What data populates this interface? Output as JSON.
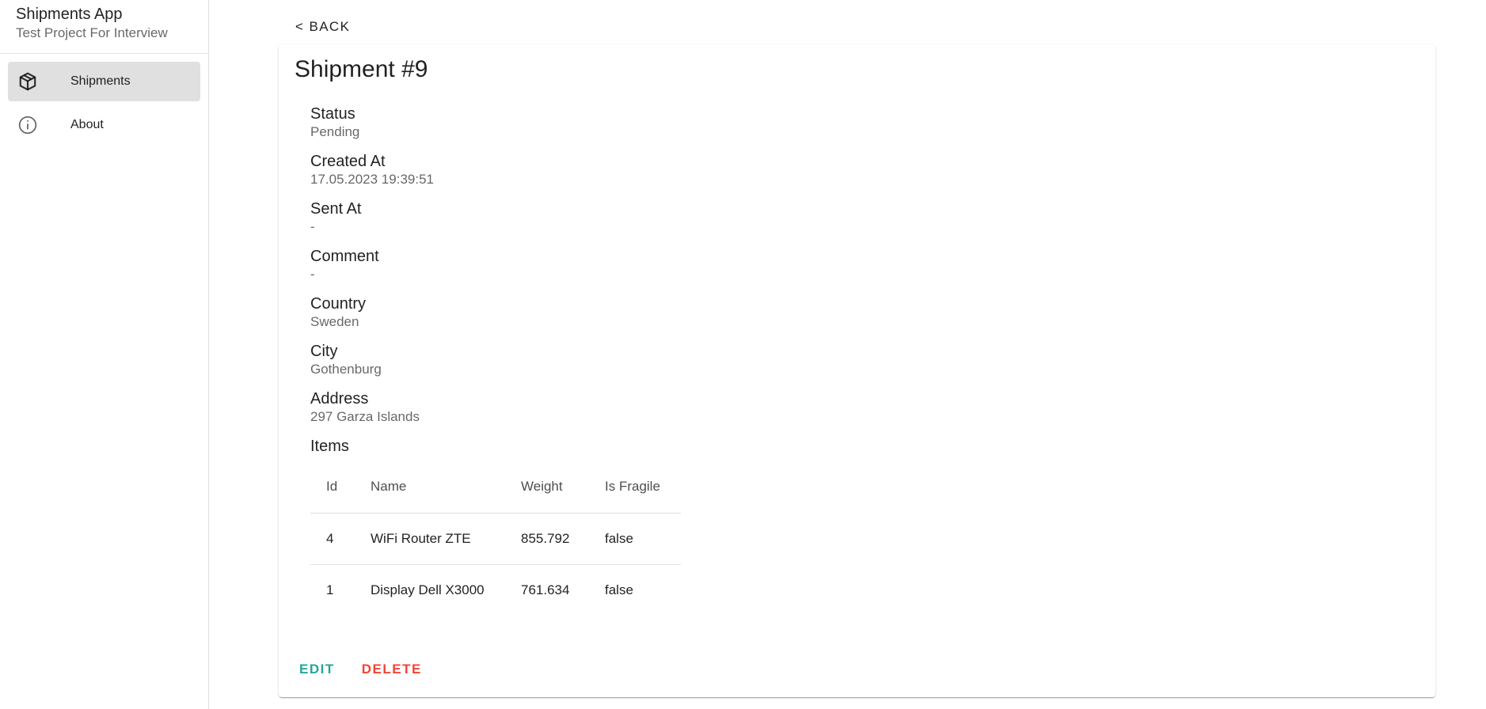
{
  "app": {
    "title": "Shipments App",
    "subtitle": "Test Project For Interview"
  },
  "sidebar": {
    "items": [
      {
        "label": "Shipments",
        "icon": "box-icon",
        "active": true
      },
      {
        "label": "About",
        "icon": "info-icon",
        "active": false
      }
    ]
  },
  "back_label": "< BACK",
  "shipment": {
    "title": "Shipment #9",
    "fields": [
      {
        "label": "Status",
        "value": "Pending"
      },
      {
        "label": "Created At",
        "value": "17.05.2023 19:39:51"
      },
      {
        "label": "Sent At",
        "value": "-"
      },
      {
        "label": "Comment",
        "value": "-"
      },
      {
        "label": "Country",
        "value": "Sweden"
      },
      {
        "label": "City",
        "value": "Gothenburg"
      },
      {
        "label": "Address",
        "value": "297 Garza Islands"
      }
    ],
    "items_label": "Items",
    "items_table": {
      "headers": [
        "Id",
        "Name",
        "Weight",
        "Is Fragile"
      ],
      "rows": [
        [
          "4",
          "WiFi Router ZTE",
          "855.792",
          "false"
        ],
        [
          "1",
          "Display Dell X3000",
          "761.634",
          "false"
        ]
      ]
    }
  },
  "actions": {
    "edit_label": "EDIT",
    "delete_label": "DELETE"
  },
  "colors": {
    "edit": "#26a69a",
    "delete": "#f44336",
    "active_nav": "#e0e0e0"
  }
}
